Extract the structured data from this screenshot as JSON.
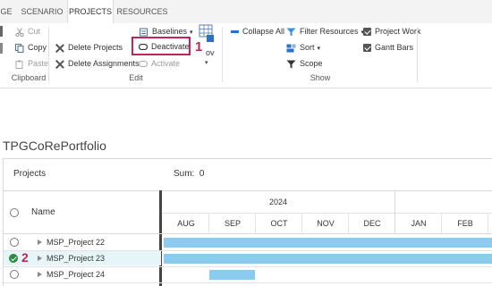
{
  "ribbon": {
    "tabs": [
      {
        "label": "GE",
        "active": false
      },
      {
        "label": "SCENARIO",
        "active": false
      },
      {
        "label": "PROJECTS",
        "active": true
      },
      {
        "label": "RESOURCES",
        "active": false
      }
    ],
    "clipboard": {
      "cut": "Cut",
      "copy": "Copy",
      "paste": "Paste",
      "label": "Clipboard"
    },
    "edit": {
      "delete_projects": "Delete Projects",
      "delete_assignments": "Delete Assignments",
      "baselines": "Baselines",
      "deactivate": "Deactivate",
      "activate": "Activate",
      "move_partial": "ove",
      "label": "Edit"
    },
    "show": {
      "collapse_all": "Collapse All",
      "filter_resources": "Filter Resources",
      "sort": "Sort",
      "scope": "Scope",
      "project_work": "Project Work",
      "gantt_bars": "Gantt Bars",
      "label": "Show"
    },
    "annotation_1": "1"
  },
  "page": {
    "title": "TPGCoRePortfolio",
    "projects_label": "Projects",
    "sum_label": "Sum:",
    "sum_value": "0",
    "name_header": "Name",
    "year": "2024",
    "months": [
      "AUG",
      "SEP",
      "OCT",
      "NOV",
      "DEC",
      "JAN",
      "FEB"
    ],
    "annotation_2": "2",
    "bar_color": "#8ccbf0",
    "selected_row_color": "#e6f6f8",
    "annotation_color": "#c3255a",
    "rows": [
      {
        "name": "MSP_Project 22",
        "selected": false
      },
      {
        "name": "MSP_Project 23",
        "selected": true
      },
      {
        "name": "MSP_Project 24",
        "selected": false
      }
    ]
  }
}
